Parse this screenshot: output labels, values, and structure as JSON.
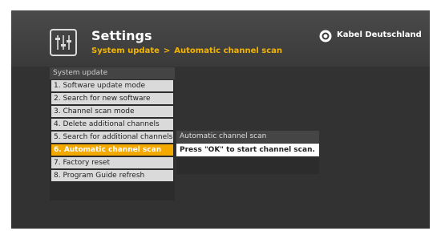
{
  "header": {
    "title": "Settings",
    "breadcrumb": [
      "System update",
      "Automatic channel scan"
    ],
    "breadcrumb_separator": ">",
    "icon": "settings-sliders-icon"
  },
  "brand": {
    "name": "Kabel Deutschland",
    "logo_icon": "kabel-deutschland-logo-icon"
  },
  "menu": {
    "title": "System update",
    "items": [
      {
        "label": "1. Software update mode"
      },
      {
        "label": "2. Search for new software"
      },
      {
        "label": "3. Channel scan mode"
      },
      {
        "label": "4. Delete additional channels"
      },
      {
        "label": "5. Search for additional channels"
      },
      {
        "label": "6. Automatic channel scan",
        "selected": true
      },
      {
        "label": "7. Factory reset"
      },
      {
        "label": "8. Program Guide refresh"
      }
    ]
  },
  "info": {
    "title": "Automatic channel scan",
    "message": "Press \"OK\" to start channel scan."
  },
  "colors": {
    "accent": "#f4a900",
    "background": "#323232",
    "menu_item": "#dadada"
  }
}
